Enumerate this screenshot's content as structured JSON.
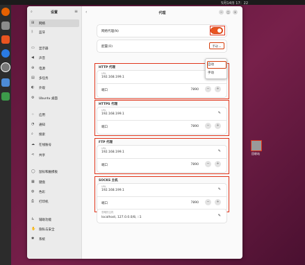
{
  "topbar": {
    "clock": "5月14日 17：22"
  },
  "dock": {
    "apps": [
      "firefox-icon",
      "files-icon",
      "app-center-icon",
      "help-icon",
      "settings-icon",
      "text-editor-icon",
      "trash-icon"
    ]
  },
  "sidebar": {
    "title": "设置",
    "items": [
      {
        "label": "网络",
        "icon": "network-icon",
        "active": true
      },
      {
        "label": "蓝牙",
        "icon": "bluetooth-icon"
      },
      {
        "label": "显示器",
        "icon": "display-icon"
      },
      {
        "label": "声音",
        "icon": "sound-icon"
      },
      {
        "label": "电源",
        "icon": "power-icon"
      },
      {
        "label": "多任务",
        "icon": "multitask-icon"
      },
      {
        "label": "外观",
        "icon": "appearance-icon"
      },
      {
        "label": "Ubuntu 桌面",
        "icon": "ubuntu-desktop-icon"
      },
      {
        "label": "应用",
        "icon": "apps-icon"
      },
      {
        "label": "通知",
        "icon": "notifications-icon"
      },
      {
        "label": "搜索",
        "icon": "search-icon"
      },
      {
        "label": "在线账号",
        "icon": "online-accounts-icon"
      },
      {
        "label": "共享",
        "icon": "sharing-icon"
      },
      {
        "label": "鼠标和触摸板",
        "icon": "mouse-icon"
      },
      {
        "label": "键盘",
        "icon": "keyboard-icon"
      },
      {
        "label": "色彩",
        "icon": "color-icon"
      },
      {
        "label": "打印机",
        "icon": "printer-icon"
      },
      {
        "label": "辅助功能",
        "icon": "accessibility-icon"
      },
      {
        "label": "隐私与安全",
        "icon": "privacy-icon"
      },
      {
        "label": "系统",
        "icon": "system-icon"
      }
    ]
  },
  "main": {
    "title": "代理",
    "network_proxy_label": "网络代理(N)",
    "network_proxy_on": true,
    "config_label": "配置(O)",
    "config_value": "手动",
    "config_options": [
      "自动",
      "手动"
    ],
    "proxies": [
      {
        "title": "HTTP 代理",
        "url_label": "URL",
        "host": "192.168.199.1",
        "port_label": "端口",
        "port": "7890"
      },
      {
        "title": "HTTPS 代理",
        "url_label": "URL",
        "host": "192.168.199.1",
        "port_label": "端口",
        "port": "7890"
      },
      {
        "title": "FTP 代理",
        "url_label": "URL",
        "host": "192.168.199.1",
        "port_label": "端口",
        "port": "7890"
      },
      {
        "title": "SOCKS 主机",
        "url_label": "URL",
        "host": "192.168.199.1",
        "port_label": "端口",
        "port": "7890"
      }
    ],
    "ignore_label": "忽略的主机",
    "ignore_value": "localhost, 127.0.0.0/8, ::1"
  },
  "desktop": {
    "icon_label": "回收站"
  },
  "colors": {
    "accent": "#e95420",
    "highlight": "#e0341a"
  }
}
